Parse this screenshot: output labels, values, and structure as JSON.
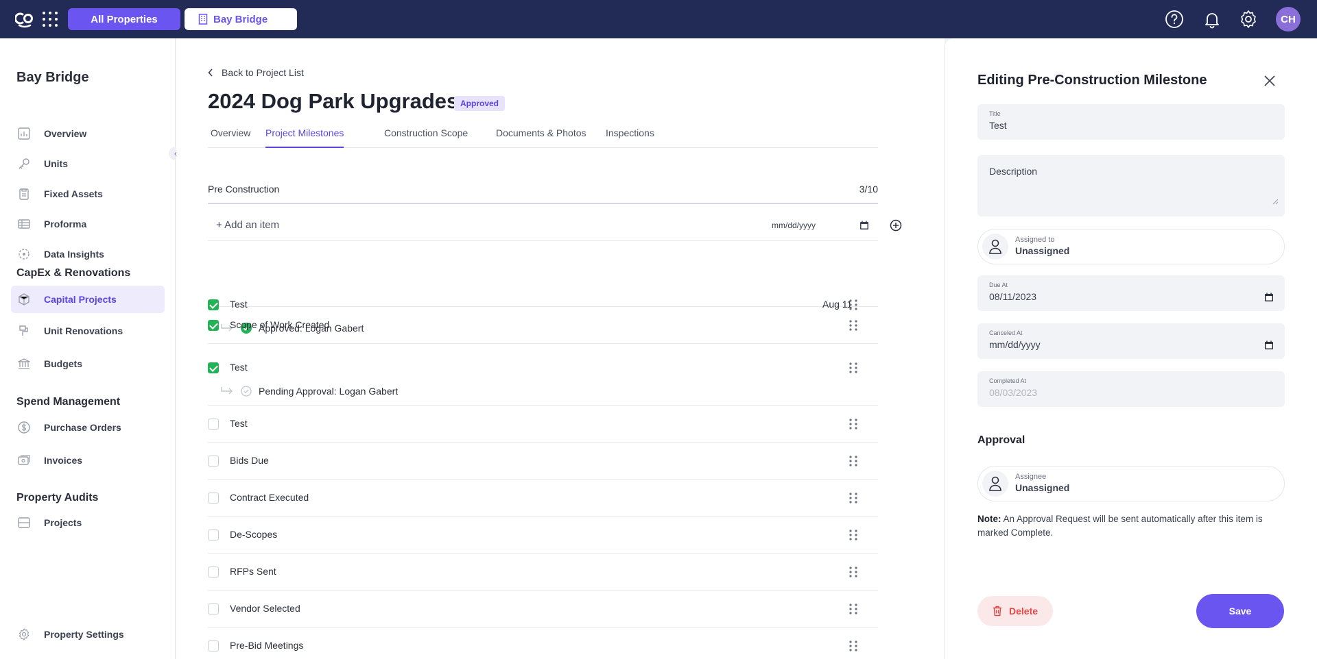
{
  "topbar": {
    "all_properties_label": "All Properties",
    "property_label": "Bay Bridge",
    "avatar_initials": "CH"
  },
  "sidebar": {
    "title": "Bay Bridge",
    "items_main": [
      {
        "label": "Overview",
        "icon": "chart-icon"
      },
      {
        "label": "Units",
        "icon": "key-icon"
      },
      {
        "label": "Fixed Assets",
        "icon": "clipboard-icon"
      },
      {
        "label": "Proforma",
        "icon": "table-icon"
      },
      {
        "label": "Data Insights",
        "icon": "insights-icon"
      }
    ],
    "section_capex": "CapEx & Renovations",
    "items_capex": [
      {
        "label": "Capital Projects",
        "icon": "cube-icon",
        "active": true
      },
      {
        "label": "Unit Renovations",
        "icon": "paint-icon"
      },
      {
        "label": "Budgets",
        "icon": "bank-icon"
      }
    ],
    "section_spend": "Spend Management",
    "items_spend": [
      {
        "label": "Purchase Orders",
        "icon": "dollar-icon"
      },
      {
        "label": "Invoices",
        "icon": "invoice-icon"
      }
    ],
    "section_audits": "Property Audits",
    "items_audits": [
      {
        "label": "Projects",
        "icon": "projects-icon"
      }
    ],
    "settings_label": "Property Settings"
  },
  "main": {
    "back_label": "Back to Project List",
    "project_title": "2024 Dog Park Upgrades",
    "status_badge": "Approved",
    "tabs": [
      {
        "label": "Overview"
      },
      {
        "label": "Project Milestones",
        "active": true
      },
      {
        "label": "Construction Scope"
      },
      {
        "label": "Documents & Photos"
      },
      {
        "label": "Inspections"
      }
    ],
    "section": {
      "title": "Pre Construction",
      "count": "3/10"
    },
    "add_item": {
      "placeholder": "+ Add an item",
      "date_placeholder": "mm/dd/yyyy"
    },
    "milestones": [
      {
        "label": "Test",
        "checked": true,
        "date": "Aug 11",
        "approval": "Approved: Logan Gabert",
        "approval_status": "approved"
      },
      {
        "label": "Scope of Work Created",
        "checked": true
      },
      {
        "label": "Test",
        "checked": true,
        "approval": "Pending Approval: Logan Gabert",
        "approval_status": "pending"
      },
      {
        "label": "Test",
        "checked": false
      },
      {
        "label": "Bids Due",
        "checked": false
      },
      {
        "label": "Contract Executed",
        "checked": false
      },
      {
        "label": "De-Scopes",
        "checked": false
      },
      {
        "label": "RFPs Sent",
        "checked": false
      },
      {
        "label": "Vendor Selected",
        "checked": false
      },
      {
        "label": "Pre-Bid Meetings",
        "checked": false
      }
    ]
  },
  "panel": {
    "title": "Editing Pre-Construction Milestone",
    "title_field": {
      "label": "Title",
      "value": "Test"
    },
    "description_field": {
      "label": "Description",
      "value": ""
    },
    "assigned": {
      "label": "Assigned to",
      "value": "Unassigned"
    },
    "due_at": {
      "label": "Due At",
      "value": "08/11/2023"
    },
    "canceled_at": {
      "label": "Canceled At",
      "value": "mm/dd/yyyy"
    },
    "completed_at": {
      "label": "Completed At",
      "value": "08/03/2023"
    },
    "approval_title": "Approval",
    "assignee": {
      "label": "Assignee",
      "value": "Unassigned"
    },
    "note_bold": "Note:",
    "note_text": " An Approval Request will be sent automatically after this item is marked Complete.",
    "delete_label": "Delete",
    "save_label": "Save"
  },
  "colors": {
    "topbar": "#222b55",
    "accent": "#6b55f0",
    "success": "#22b357",
    "danger": "#e04848"
  }
}
